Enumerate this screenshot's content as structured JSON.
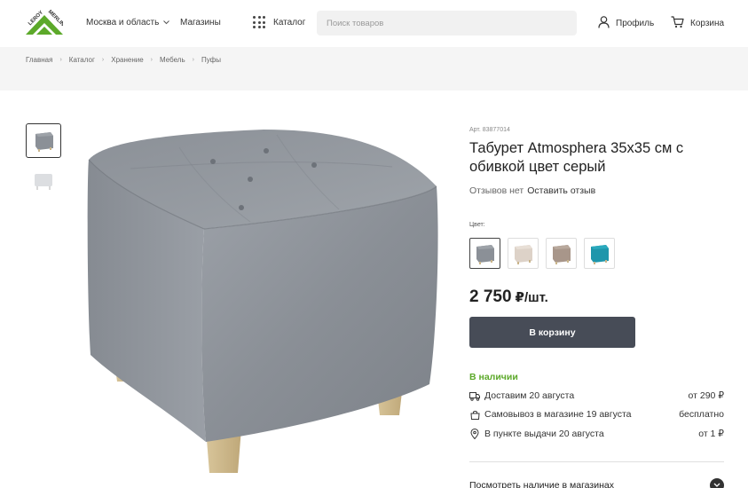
{
  "header": {
    "logo_text": "LEROY MERLIN",
    "region": "Москва и область",
    "stores": "Магазины",
    "catalog": "Каталог",
    "search_placeholder": "Поиск товаров",
    "profile": "Профиль",
    "cart": "Корзина"
  },
  "breadcrumbs": [
    "Главная",
    "Каталог",
    "Хранение",
    "Мебель",
    "Пуфы"
  ],
  "product": {
    "sku": "Арт. 83877014",
    "title": "Табурет Atmosphera 35x35 см с обивкой цвет серый",
    "reviews_none": "Отзывов нет",
    "leave_review": "Оставить отзыв",
    "color_label": "Цвет:",
    "swatches": [
      {
        "name": "серый",
        "color": "#8b9097",
        "selected": true
      },
      {
        "name": "бежевый",
        "color": "#ddd2c8",
        "selected": false
      },
      {
        "name": "тауп",
        "color": "#a8968a",
        "selected": false
      },
      {
        "name": "бирюзовый",
        "color": "#1e96ab",
        "selected": false
      }
    ],
    "price": "2 750",
    "price_unit": "₽/шт.",
    "buy_button": "В корзину"
  },
  "availability": {
    "status": "В наличии",
    "rows": [
      {
        "icon": "truck-icon",
        "text": "Доставим 20 августа",
        "price": "от 290 ₽"
      },
      {
        "icon": "bag-icon",
        "text": "Самовывоз в магазине 19 августа",
        "price": "бесплатно"
      },
      {
        "icon": "pin-icon",
        "text": "В пункте выдачи 20 августа",
        "price": "от 1 ₽"
      }
    ],
    "see_stores": "Посмотреть наличие в магазинах"
  },
  "colors": {
    "accent_green": "#5ca92a",
    "button_dark": "#474c57"
  }
}
